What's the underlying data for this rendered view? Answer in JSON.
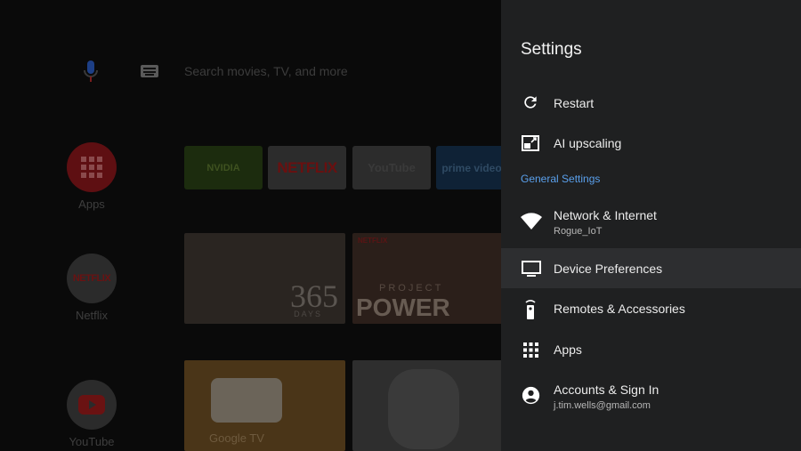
{
  "home": {
    "search": {
      "placeholder": "Search movies, TV, and more"
    },
    "nav": [
      {
        "label": "Apps"
      },
      {
        "label": "Netflix",
        "logo": "NETFLIX"
      },
      {
        "label": "YouTube"
      }
    ],
    "apps_row": [
      {
        "name": "NVIDIA"
      },
      {
        "name": "NETFLIX"
      },
      {
        "name": "YouTube"
      },
      {
        "name": "prime video"
      }
    ],
    "posters_row1": [
      {
        "title": "365",
        "subtitle": "DAYS"
      },
      {
        "badge": "NETFLIX",
        "kicker": "PROJECT",
        "title": "POWER"
      }
    ],
    "posters_row2": [
      {
        "title": "Google TV"
      },
      {
        "title": ""
      }
    ]
  },
  "settings": {
    "title": "Settings",
    "quick": [
      {
        "label": "Restart",
        "icon": "restart-icon"
      },
      {
        "label": "AI upscaling",
        "icon": "ai-upscaling-icon"
      }
    ],
    "section_label": "General Settings",
    "general": [
      {
        "label": "Network & Internet",
        "sub": "Rogue_IoT",
        "icon": "wifi-icon"
      },
      {
        "label": "Device Preferences",
        "icon": "tv-icon",
        "selected": true
      },
      {
        "label": "Remotes & Accessories",
        "icon": "remote-icon"
      },
      {
        "label": "Apps",
        "icon": "apps-grid-icon"
      },
      {
        "label": "Accounts & Sign In",
        "sub": "j.tim.wells@gmail.com",
        "icon": "account-icon"
      }
    ]
  },
  "colors": {
    "panel_bg": "#1f2021",
    "accent": "#5aa0ec",
    "selected_row": "#2d2e30"
  }
}
